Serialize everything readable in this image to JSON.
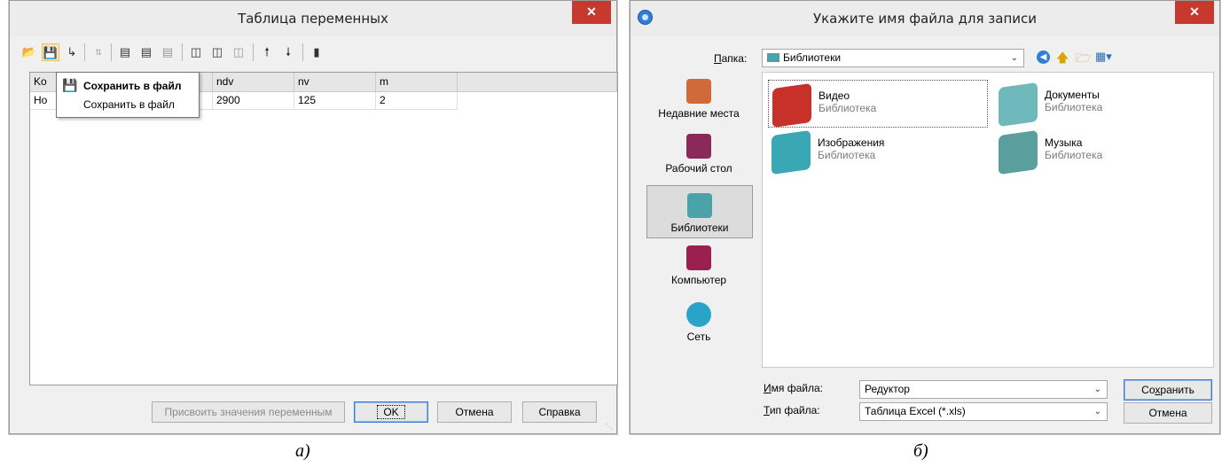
{
  "left_window": {
    "title": "Таблица переменных",
    "close": "✕",
    "toolbar_icons": [
      "open-icon",
      "save-icon",
      "export-icon",
      "sort-icon",
      "insert-row-icon",
      "add-row-icon",
      "delete-row-icon",
      "insert-column-icon",
      "add-column-icon",
      "delete-column-icon",
      "move-up-icon",
      "move-down-icon",
      "panel-icon"
    ],
    "columns": [
      "Ko",
      "",
      "ndv",
      "nv",
      "m"
    ],
    "row": [
      "Ho",
      "",
      "2900",
      "125",
      "2"
    ],
    "tooltip": {
      "title": "Сохранить в файл",
      "text": "Сохранить в файл"
    },
    "buttons": {
      "assign": "Присвоить значения переменным",
      "ok": "OK",
      "cancel": "Отмена",
      "help": "Справка"
    }
  },
  "right_window": {
    "title": "Укажите имя файла для записи",
    "close": "✕",
    "folder_label_u": "П",
    "folder_label_rest": "апка:",
    "folder_value": "Библиотеки",
    "places": [
      {
        "label": "Недавние места",
        "color": "#d06a3a"
      },
      {
        "label": "Рабочий стол",
        "color": "#8a2a5a"
      },
      {
        "label": "Библиотеки",
        "color": "#4aa3a8"
      },
      {
        "label": "Компьютер",
        "color": "#9a2050"
      },
      {
        "label": "Сеть",
        "color": "#2aa3c8"
      }
    ],
    "files": [
      {
        "name": "Видео",
        "type": "Библиотека",
        "color": "#c8302a"
      },
      {
        "name": "Документы",
        "type": "Библиотека",
        "color": "#6fb9bd"
      },
      {
        "name": "Изображения",
        "type": "Библиотека",
        "color": "#3aa7b5"
      },
      {
        "name": "Музыка",
        "type": "Библиотека",
        "color": "#5a9e9e"
      }
    ],
    "filename_label_u": "И",
    "filename_label_rest": "мя файла:",
    "filename_value": "Редуктор",
    "filetype_label_u": "Т",
    "filetype_label_rest": "ип файла:",
    "filetype_value": "Таблица Excel (*.xls)",
    "save_pre": "Со",
    "save_u": "х",
    "save_post": "ранить",
    "cancel": "Отмена"
  },
  "captions": {
    "a": "а)",
    "b": "б)"
  }
}
